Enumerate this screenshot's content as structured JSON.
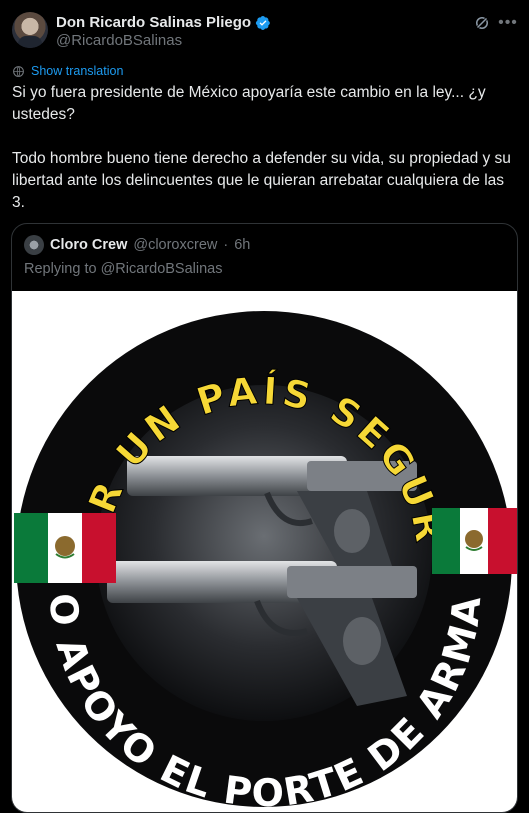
{
  "author": {
    "display_name": "Don Ricardo Salinas Pliego",
    "handle": "@RicardoBSalinas",
    "verified": true
  },
  "actions": {
    "translate_label": "Show translation"
  },
  "tweet": {
    "text": "Si yo fuera presidente de México apoyaría este cambio en la ley... ¿y ustedes?\n\nTodo hombre bueno tiene derecho a defender su vida, su propiedad y su libertad ante los delincuentes que le quieran arrebatar cualquiera de las 3."
  },
  "quote": {
    "display_name": "Cloro Crew",
    "handle": "@cloroxcrew",
    "separator": "·",
    "time": "6h",
    "reply_line": "Replying to @RicardoBSalinas",
    "image": {
      "top_text": "POR UN PAÍS SEGURO",
      "bottom_text": "YO APOYO EL PORTE DE ARMAS"
    }
  },
  "colors": {
    "background": "#000000",
    "text": "#e7e9ea",
    "muted": "#71767b",
    "link": "#1d9bf0",
    "border": "#2f3336",
    "emblem_yellow": "#f6d836",
    "flag_green": "#0a7a3a",
    "flag_red": "#c8102e"
  },
  "icons": {
    "verified": "verified-badge-icon",
    "grok": "grok-icon",
    "more": "more-icon",
    "translate": "globe-icon"
  }
}
